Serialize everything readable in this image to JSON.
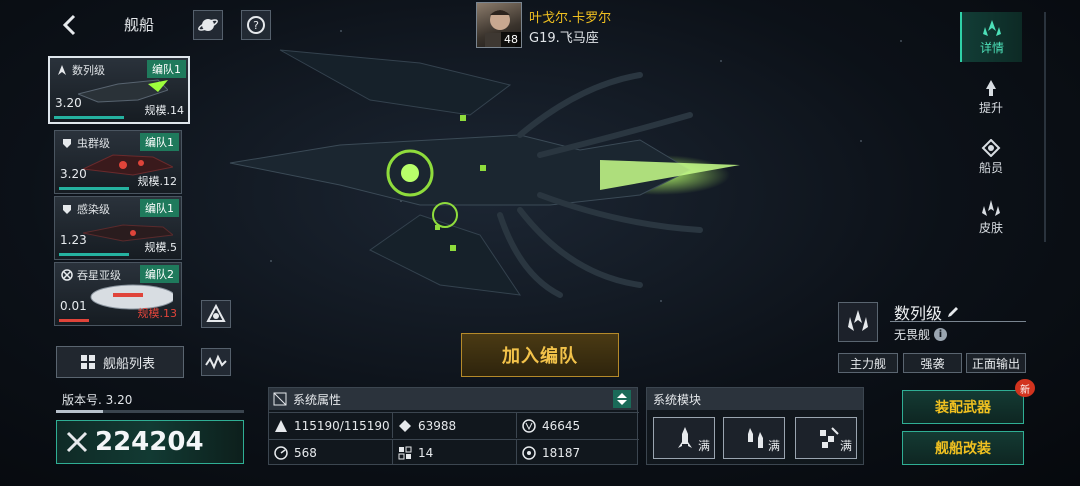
{
  "header": {
    "title": "舰船",
    "back_icon": "back-arrow-icon",
    "planet_icon": "planet-icon",
    "help_icon": "help-icon"
  },
  "commander": {
    "name": "叶戈尔.卡罗尔",
    "level": "48",
    "rank": "G19.飞马座"
  },
  "ship_list": [
    {
      "class": "数列级",
      "fleet": "编队1",
      "power": "3.20",
      "scale": "规模.14",
      "selected": true,
      "scale_red": false
    },
    {
      "class": "虫群级",
      "fleet": "编队1",
      "power": "3.20",
      "scale": "规模.12",
      "selected": false,
      "scale_red": false
    },
    {
      "class": "感染级",
      "fleet": "编队1",
      "power": "1.23",
      "scale": "规模.5",
      "selected": false,
      "scale_red": false
    },
    {
      "class": "吞星亚级",
      "fleet": "编队2",
      "power": "0.01",
      "scale": "规模.13",
      "selected": false,
      "scale_red": true
    }
  ],
  "ship_list_button": "舰船列表",
  "version": {
    "label": "版本号. 3.20",
    "progress": 0.25
  },
  "power": {
    "value": "224204",
    "icon": "crossed-swords-icon"
  },
  "join_fleet_button": "加入编队",
  "attributes": {
    "header": "系统属性",
    "items": [
      {
        "icon": "hull-icon",
        "value": "115190/115190"
      },
      {
        "icon": "armor-icon",
        "value": "63988"
      },
      {
        "icon": "shield-icon",
        "value": "46645"
      },
      {
        "icon": "speed-icon",
        "value": "568"
      },
      {
        "icon": "grid-icon",
        "value": "14"
      },
      {
        "icon": "target-icon",
        "value": "18187"
      }
    ]
  },
  "modules": {
    "header": "系统模块",
    "slots": [
      {
        "icon": "missile-icon",
        "status": "满"
      },
      {
        "icon": "rockets-icon",
        "status": "满"
      },
      {
        "icon": "drones-icon",
        "status": "满"
      }
    ]
  },
  "ship_info": {
    "class_name": "数列级",
    "subtype": "无畏舰",
    "tags": [
      "主力舰",
      "强袭",
      "正面输出"
    ]
  },
  "actions": {
    "equip_weapon": "装配武器",
    "modify_ship": "舰船改装",
    "new_badge": "新"
  },
  "right_nav": [
    {
      "label": "详情",
      "icon": "details-icon",
      "active": true
    },
    {
      "label": "提升",
      "icon": "upgrade-icon",
      "active": false
    },
    {
      "label": "船员",
      "icon": "crew-icon",
      "active": false
    },
    {
      "label": "皮肤",
      "icon": "skin-icon",
      "active": false
    }
  ],
  "colors": {
    "accent_green": "#2fae94",
    "gold": "#f0c020",
    "red": "#e0443a"
  }
}
